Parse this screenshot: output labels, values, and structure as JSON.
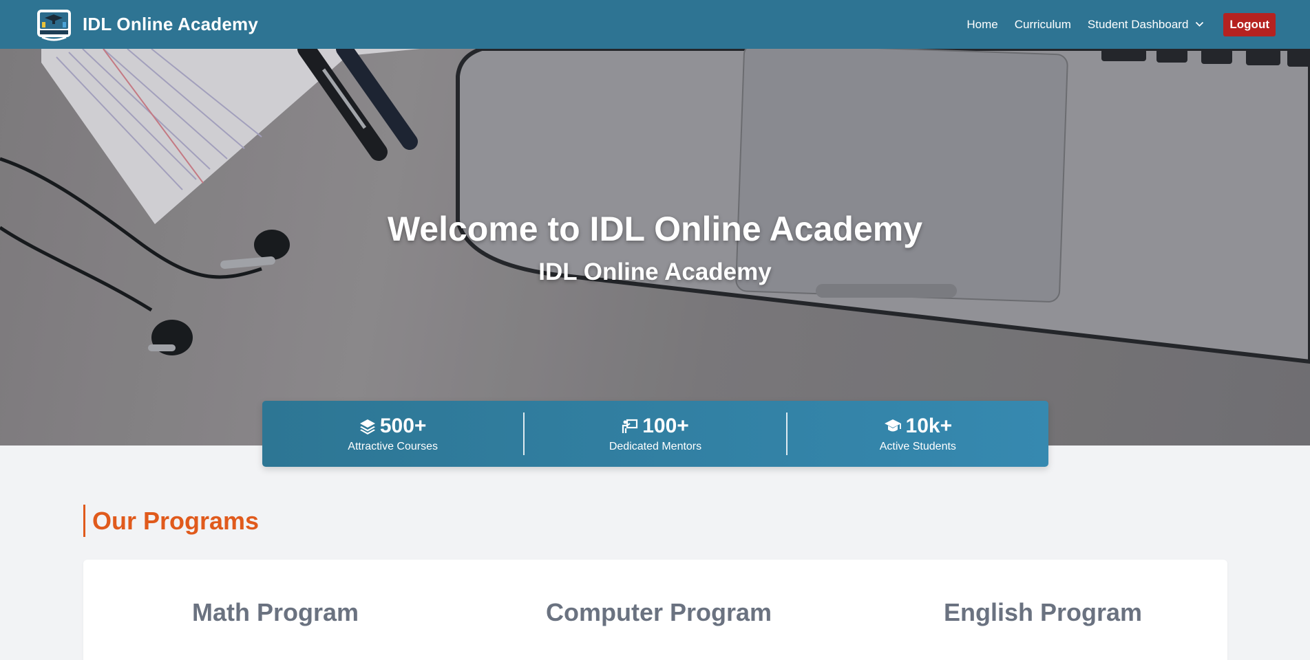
{
  "navbar": {
    "brand_name": "IDL Online Academy",
    "logo_icon": "academy-logo-icon",
    "links": [
      {
        "label": "Home"
      },
      {
        "label": "Curriculum"
      },
      {
        "label": "Student Dashboard",
        "has_dropdown": true
      }
    ],
    "logout_label": "Logout"
  },
  "hero": {
    "title": "Welcome to IDL Online Academy",
    "subtitle": "IDL Online Academy"
  },
  "stats": [
    {
      "icon": "layers-icon",
      "value": "500+",
      "label": "Attractive Courses"
    },
    {
      "icon": "mentor-icon",
      "value": "100+",
      "label": "Dedicated Mentors"
    },
    {
      "icon": "graduation-cap-icon",
      "value": "10k+",
      "label": "Active Students"
    }
  ],
  "programs": {
    "heading": "Our Programs",
    "items": [
      {
        "title": "Math Program"
      },
      {
        "title": "Computer Program"
      },
      {
        "title": "English Program"
      }
    ]
  },
  "colors": {
    "navbar": "#2e7493",
    "logout": "#b52220",
    "accent": "#e05a1c",
    "stats_start": "#2d7694",
    "stats_end": "#3689b0",
    "program_text": "#6a7280"
  }
}
